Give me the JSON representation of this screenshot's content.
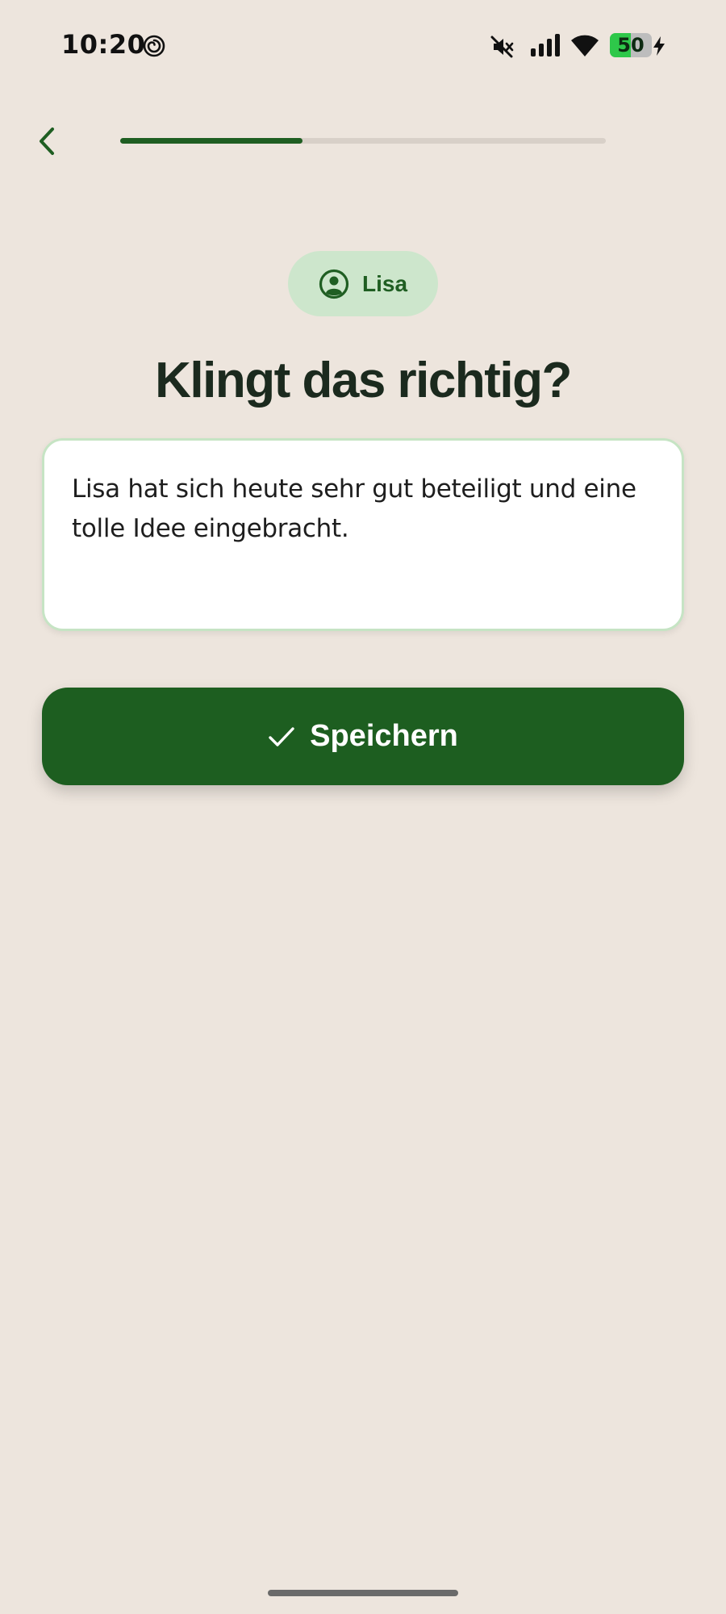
{
  "status_bar": {
    "time": "10:20",
    "battery_level": "50",
    "battery_fraction": 0.5,
    "battery_color": "#2ec84a",
    "icons": [
      "spiral-icon",
      "mute-icon",
      "signal-icon",
      "wifi-icon",
      "battery-icon",
      "charging-bolt-icon"
    ]
  },
  "header": {
    "back_icon": "chevron-left-icon",
    "progress_fraction": 0.375
  },
  "student": {
    "icon": "user-circle-icon",
    "name": "Lisa"
  },
  "main": {
    "title": "Klingt das richtig?",
    "feedback_text": "Lisa hat sich heute sehr gut beteiligt und eine tolle Idee eingebracht."
  },
  "actions": {
    "save_icon": "check-icon",
    "save_label": "Speichern"
  },
  "colors": {
    "background": "#ede5dd",
    "primary": "#1d5e20",
    "chip_background": "#cde6cc",
    "card_border": "#c6e4c4",
    "title_text": "#1b2a1e"
  }
}
